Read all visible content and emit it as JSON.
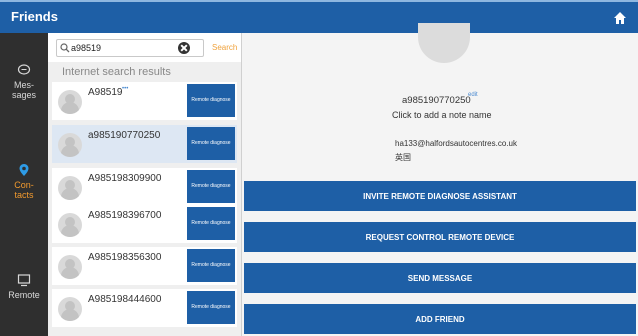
{
  "header": {
    "title": "Friends",
    "home_icon": "home-icon"
  },
  "sidebar": {
    "items": [
      {
        "label_line1": "Mes-",
        "label_line2": "sages",
        "icon": "chat-icon",
        "active": false
      },
      {
        "label_line1": "Con-",
        "label_line2": "tacts",
        "icon": "location-pin-icon",
        "active": true
      },
      {
        "label_line1": "Remote",
        "label_line2": "",
        "icon": "monitor-icon",
        "active": false
      }
    ],
    "active_color": "#f29a2e"
  },
  "search": {
    "value": "a98519",
    "search_label": "Search"
  },
  "results": {
    "title": "Internet search results",
    "button_label": "Remote diagnose",
    "items": [
      {
        "name": "A98519",
        "tag": "•••"
      },
      {
        "name": "a985190770250",
        "tag": ""
      },
      {
        "name": "A985198309900",
        "tag": ""
      },
      {
        "name": "A985198396700",
        "tag": ""
      },
      {
        "name": "A985198356300",
        "tag": ""
      },
      {
        "name": "A985198444600",
        "tag": ""
      }
    ]
  },
  "detail": {
    "id": "a985190770250",
    "edit_label": "edit",
    "note": "Click to add a note name",
    "email": "ha133@halfordsautocentres.co.uk",
    "country": "英国"
  },
  "actions": {
    "invite": "INVITE REMOTE DIAGNOSE ASSISTANT",
    "request": "REQUEST CONTROL REMOTE DEVICE",
    "send": "SEND MESSAGE",
    "add": "ADD FRIEND"
  },
  "colors": {
    "primary": "#1e5fa6",
    "sidebar_bg": "#2f2f2f",
    "accent": "#f0a23c"
  }
}
